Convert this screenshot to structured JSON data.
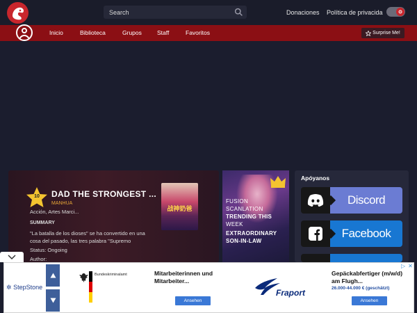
{
  "header": {
    "search_placeholder": "Search",
    "links": [
      "Donaciones",
      "Política de privacida"
    ]
  },
  "nav": {
    "items": [
      "Inicio",
      "Biblioteca",
      "Grupos",
      "Staff",
      "Favoritos"
    ],
    "surprise_label": "Surprise Me!"
  },
  "featured": {
    "rank": "10",
    "title": "DAD THE STRONGEST ...",
    "type": "MANHUA",
    "genres": "Acción, Artes Marci...",
    "summary_heading": "SUMMARY",
    "summary": "\"La batalla de los dioses\" se ha convertido en una cosa del pasado, las tres palabra \"Supremo",
    "status": "Status: Ongoing",
    "author": "Author:",
    "cover_text": "战神奶爸"
  },
  "promo": {
    "lines": [
      "FUSION",
      "SCANLATION",
      "TRENDING THIS",
      "WEEK",
      "EXTRAORDINARY",
      "SON-IN-LAW"
    ]
  },
  "sidebar": {
    "heading": "Apóyanos",
    "buttons": [
      {
        "label": "Discord",
        "color": "#6b7cd3"
      },
      {
        "label": "Facebook",
        "color": "#1877d2"
      },
      {
        "label": "",
        "color": "#1877d2"
      }
    ]
  },
  "ad": {
    "brand": "StepStone",
    "bka_label": "Bundeskriminalamt",
    "ad1_text": "Mitarbeiterinnen und Mitarbeiter...",
    "ad1_button": "Ansehen",
    "ad2_title": "Gepäckabfertiger (m/w/d) am Flugh...",
    "ad2_salary": "26.000-44.000 € (geschätzt)",
    "ad2_button": "Ansehen",
    "fraport_label": "Fraport"
  },
  "colors": {
    "nav_red": "#8b0f14",
    "accent_red": "#c8262d",
    "background": "#1b1d2e"
  }
}
